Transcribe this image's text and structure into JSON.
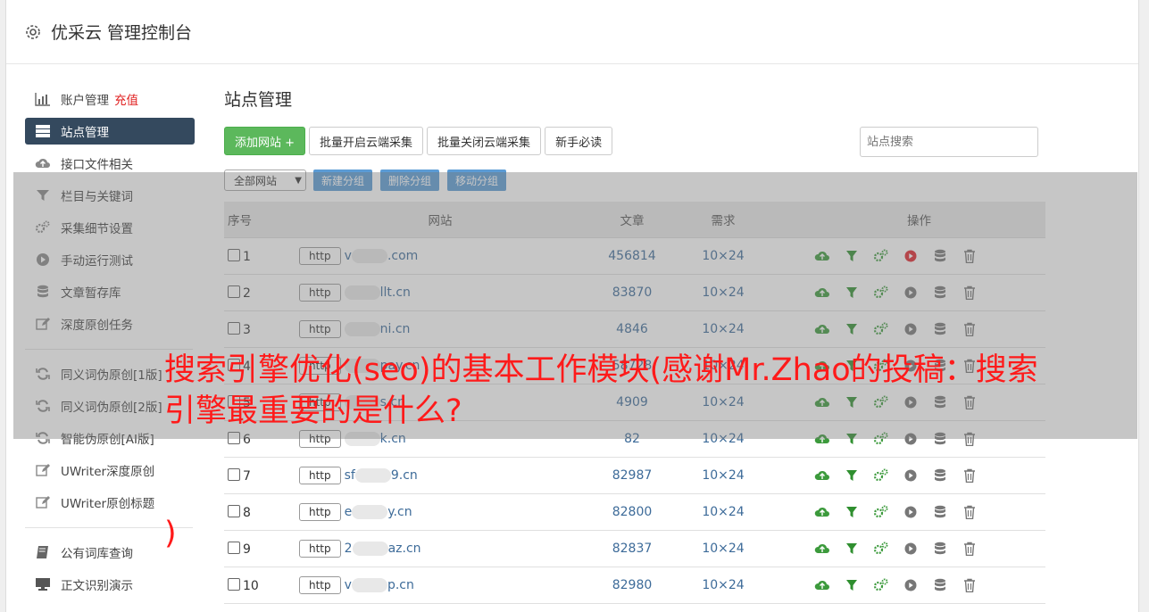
{
  "header": {
    "title": "优采云 管理控制台",
    "icon": "gear-icon"
  },
  "sidebar": {
    "group1": [
      {
        "label": "账户管理",
        "badge": "充值",
        "icon": "bar-chart-icon"
      },
      {
        "label": "站点管理",
        "icon": "server-icon",
        "active": true
      },
      {
        "label": "接口文件相关",
        "icon": "cloud-upload-icon"
      },
      {
        "label": "栏目与关键词",
        "icon": "filter-icon"
      },
      {
        "label": "采集细节设置",
        "icon": "cogs-icon"
      },
      {
        "label": "手动运行测试",
        "icon": "play-icon"
      },
      {
        "label": "文章暂存库",
        "icon": "database-icon"
      },
      {
        "label": "深度原创任务",
        "icon": "edit-icon"
      }
    ],
    "group2": [
      {
        "label": "同义词伪原创[1版]",
        "icon": "refresh-icon"
      },
      {
        "label": "同义词伪原创[2版]",
        "icon": "refresh-icon"
      },
      {
        "label": "智能伪原创[AI版]",
        "icon": "refresh-icon"
      },
      {
        "label": "UWriter深度原创",
        "icon": "edit-icon"
      },
      {
        "label": "UWriter原创标题",
        "icon": "edit-icon"
      }
    ],
    "group3": [
      {
        "label": "公有词库查询",
        "icon": "book-icon"
      },
      {
        "label": "正文识别演示",
        "icon": "monitor-icon"
      }
    ]
  },
  "main": {
    "title": "站点管理",
    "toolbar": {
      "add": "添加网站 +",
      "batch_on": "批量开启云端采集",
      "batch_off": "批量关闭云端采集",
      "guide": "新手必读",
      "search_placeholder": "站点搜索"
    },
    "groups": {
      "select": "全部网站",
      "new": "新建分组",
      "delete": "删除分组",
      "move": "移动分组"
    },
    "table": {
      "headers": [
        "序号",
        "网站",
        "文章",
        "需求",
        "操作"
      ],
      "rows": [
        {
          "num": "1",
          "proto": "http",
          "pre": "v",
          "post": ".com",
          "articles": "456814",
          "req": "10×24",
          "running": true
        },
        {
          "num": "2",
          "proto": "http",
          "pre": "",
          "post": "llt.cn",
          "articles": "83870",
          "req": "10×24",
          "running": false
        },
        {
          "num": "3",
          "proto": "http",
          "pre": "",
          "post": "ni.cn",
          "articles": "4846",
          "req": "10×24",
          "running": false
        },
        {
          "num": "4",
          "proto": "http",
          "pre": "",
          "post": "pay.cn",
          "articles": "58728",
          "req": "10×24",
          "running": false
        },
        {
          "num": "5",
          "proto": "http",
          "pre": "",
          "post": "s.cn",
          "articles": "4909",
          "req": "10×24",
          "running": false
        },
        {
          "num": "6",
          "proto": "http",
          "pre": "",
          "post": "k.cn",
          "articles": "82",
          "req": "10×24",
          "running": false
        },
        {
          "num": "7",
          "proto": "http",
          "pre": "sf",
          "post": "9.cn",
          "articles": "82987",
          "req": "10×24",
          "running": false
        },
        {
          "num": "8",
          "proto": "http",
          "pre": "e",
          "post": "y.cn",
          "articles": "82800",
          "req": "10×24",
          "running": false
        },
        {
          "num": "9",
          "proto": "http",
          "pre": "2",
          "post": "az.cn",
          "articles": "82837",
          "req": "10×24",
          "running": false
        },
        {
          "num": "10",
          "proto": "http",
          "pre": "v",
          "post": "p.cn",
          "articles": "82980",
          "req": "10×24",
          "running": false
        }
      ]
    }
  },
  "overlay": {
    "caption": "搜索引擎优化(seo)的基本工作模块(感谢Mr.Zhao的投稿：搜索引擎最重要的是什么?",
    "caption_tail": ")"
  },
  "colors": {
    "accent_green": "#5cb85c",
    "active_nav": "#34495e",
    "link_blue": "#3d6b99",
    "caption_red": "#ff1a1a"
  }
}
